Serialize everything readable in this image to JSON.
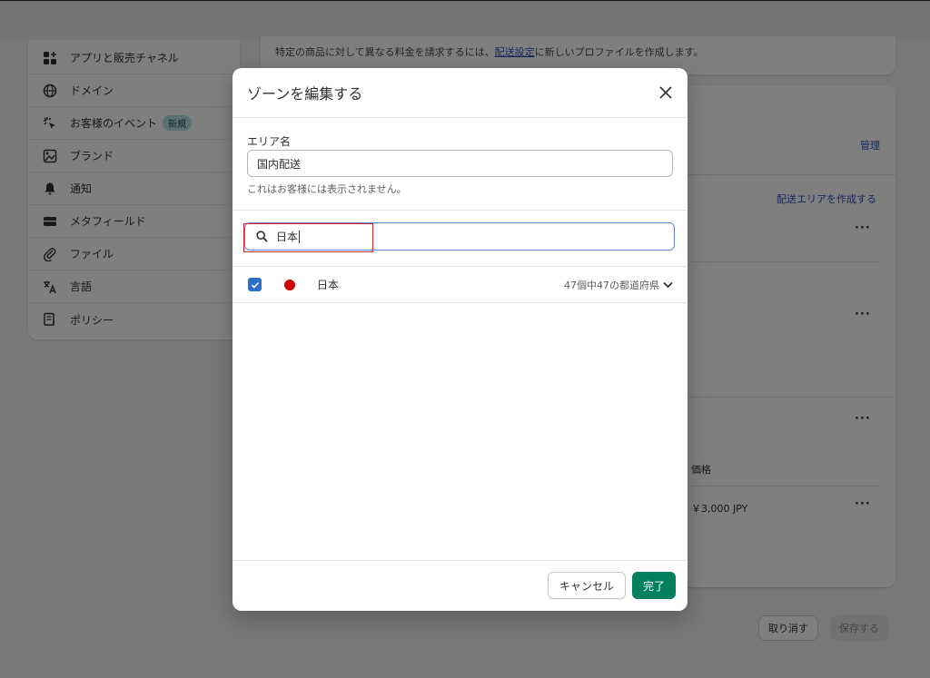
{
  "sidebar": {
    "items": [
      {
        "label": "アプリと販売チャネル",
        "icon": "apps-icon"
      },
      {
        "label": "ドメイン",
        "icon": "globe-icon"
      },
      {
        "label": "お客様のイベント",
        "icon": "cursor-click-icon",
        "badge": "新規"
      },
      {
        "label": "ブランド",
        "icon": "brand-icon"
      },
      {
        "label": "通知",
        "icon": "bell-icon"
      },
      {
        "label": "メタフィールド",
        "icon": "metafield-icon"
      },
      {
        "label": "ファイル",
        "icon": "paperclip-icon"
      },
      {
        "label": "言語",
        "icon": "translate-icon"
      },
      {
        "label": "ポリシー",
        "icon": "policy-icon"
      }
    ]
  },
  "background": {
    "info_text_before": "特定の商品に対して異なる料金を請求するには、",
    "info_link": "配送設定",
    "info_text_after": "に新しいプロファイルを作成します。",
    "manage_link": "管理",
    "create_zone_link": "配送エリアを作成する",
    "price_header": "価格",
    "price_value": "￥3,000 JPY",
    "discard_button": "取り消す",
    "save_button": "保存する"
  },
  "modal": {
    "title": "ゾーンを編集する",
    "area_label": "エリア名",
    "area_value": "国内配送",
    "area_help": "これはお客様には表示されません。",
    "search_value": "日本",
    "results": [
      {
        "country": "日本",
        "count": "47個中47の都道府県",
        "checked": true
      }
    ],
    "cancel_label": "キャンセル",
    "done_label": "完了"
  },
  "colors": {
    "accent": "#008060",
    "link": "#2c4fb5",
    "checkbox": "#2c6ecb",
    "highlight": "#d6242c",
    "flag": "#d20000"
  }
}
